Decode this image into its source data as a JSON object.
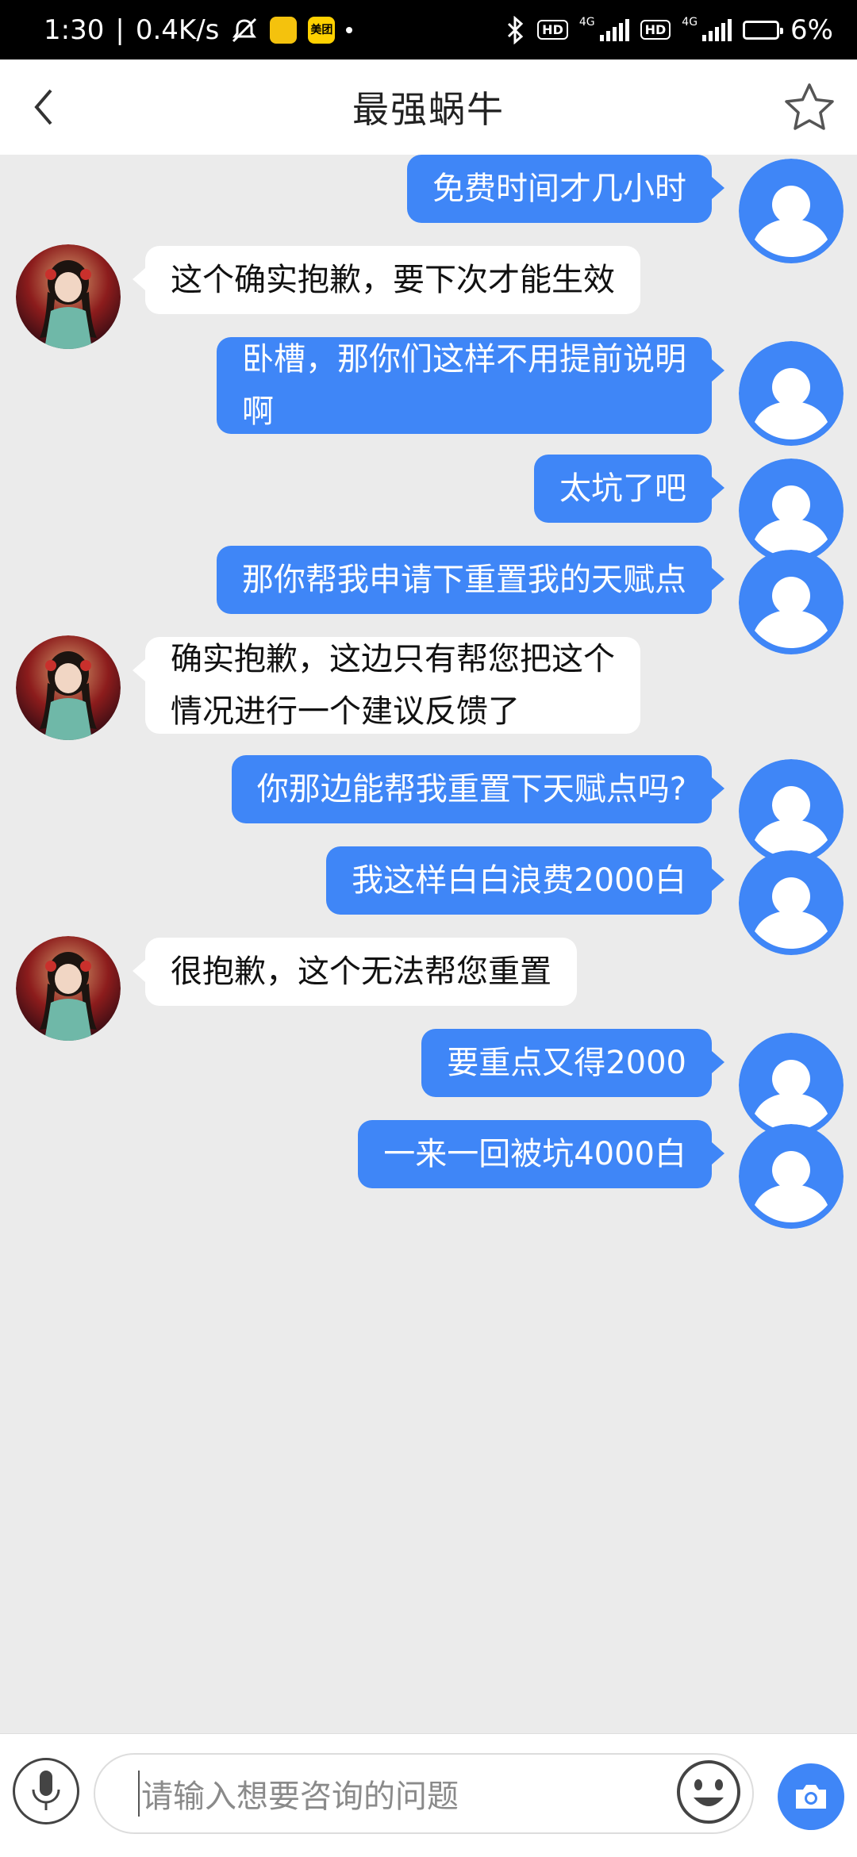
{
  "status_bar": {
    "time": "1:30",
    "speed": "0.4K/s",
    "meituan_label": "美团",
    "network_type": "4G",
    "hd_label": "HD",
    "battery": "6%"
  },
  "header": {
    "title": "最强蜗牛"
  },
  "messages": [
    {
      "from": "user",
      "text": "免费时间才几小时"
    },
    {
      "from": "agent",
      "text": "这个确实抱歉，要下次才能生效"
    },
    {
      "from": "user",
      "text": "卧槽，那你们这样不用提前说明\n啊"
    },
    {
      "from": "user",
      "text": "太坑了吧"
    },
    {
      "from": "user",
      "text": "那你帮我申请下重置我的天赋点"
    },
    {
      "from": "agent",
      "text": "确实抱歉，这边只有帮您把这个\n情况进行一个建议反馈了"
    },
    {
      "from": "user",
      "text": "你那边能帮我重置下天赋点吗?"
    },
    {
      "from": "user",
      "text": "我这样白白浪费2000白"
    },
    {
      "from": "agent",
      "text": "很抱歉，这个无法帮您重置"
    },
    {
      "from": "user",
      "text": "要重点又得2000"
    },
    {
      "from": "user",
      "text": "一来一回被坑4000白"
    }
  ],
  "input": {
    "placeholder": "请输入想要咨询的问题"
  },
  "colors": {
    "sent_bubble": "#3f86f7",
    "received_bubble": "#ffffff",
    "chat_background": "#ebebeb"
  },
  "icons": {
    "back": "chevron-left-icon",
    "favorite": "star-outline-icon",
    "voice": "microphone-icon",
    "emoji": "smiley-icon",
    "photo": "camera-icon"
  }
}
